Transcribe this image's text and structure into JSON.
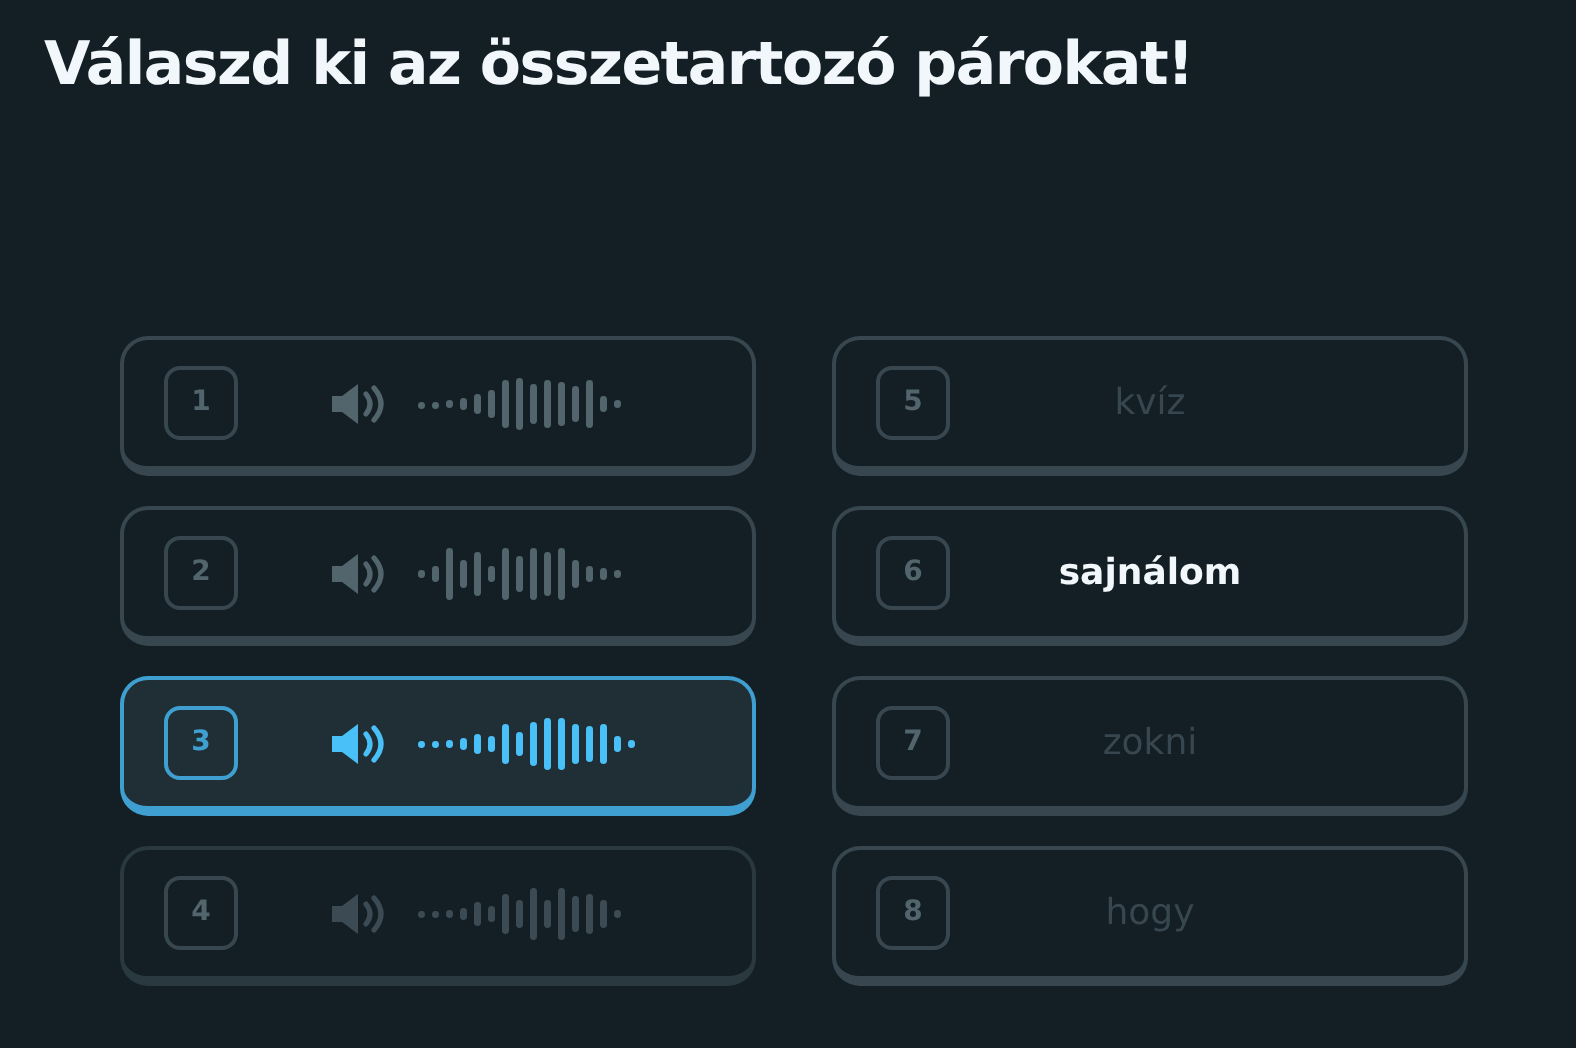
{
  "title": "Válaszd ki az összetartozó párokat!",
  "left": [
    {
      "number": "1",
      "kind": "audio",
      "selected": false,
      "disabled": false
    },
    {
      "number": "2",
      "kind": "audio",
      "selected": false,
      "disabled": false
    },
    {
      "number": "3",
      "kind": "audio",
      "selected": true,
      "disabled": false
    },
    {
      "number": "4",
      "kind": "audio",
      "selected": false,
      "disabled": true
    }
  ],
  "right": [
    {
      "number": "5",
      "kind": "word",
      "text": "kvíz",
      "selected": false,
      "disabled": true
    },
    {
      "number": "6",
      "kind": "word",
      "text": "sajnálom",
      "selected": false,
      "disabled": false
    },
    {
      "number": "7",
      "kind": "word",
      "text": "zokni",
      "selected": false,
      "disabled": true
    },
    {
      "number": "8",
      "kind": "word",
      "text": "hogy",
      "selected": false,
      "disabled": true
    }
  ]
}
